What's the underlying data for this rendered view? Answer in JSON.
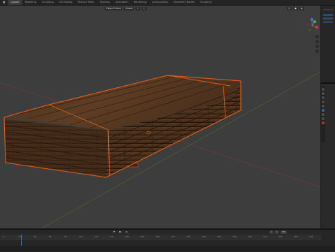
{
  "workspace_tabs": [
    "Layout",
    "Modeling",
    "Sculpting",
    "UV Editing",
    "Texture Paint",
    "Shading",
    "Animation",
    "Rendering",
    "Compositing",
    "Geometry Nodes",
    "Scripting"
  ],
  "active_tab_index": 0,
  "viewport_header": {
    "mode": "Object Mode",
    "view": "View",
    "select": "Select",
    "add": "Add",
    "object": "Object",
    "transform": "Global"
  },
  "timeline": {
    "frame_labels": [
      "0",
      "20",
      "40",
      "60",
      "80",
      "100",
      "120",
      "140",
      "160",
      "180",
      "200",
      "220",
      "240",
      "260",
      "280",
      "300",
      "320",
      "340",
      "360",
      "380",
      "400"
    ],
    "current_frame": "1",
    "start": "1",
    "end": "250"
  },
  "colors": {
    "viewport_bg": "#3d3d3d",
    "selection_outline": "#e0601a",
    "gizmo_x": "#d04050",
    "gizmo_y": "#6aa82c",
    "gizmo_z": "#3b7bd6"
  }
}
